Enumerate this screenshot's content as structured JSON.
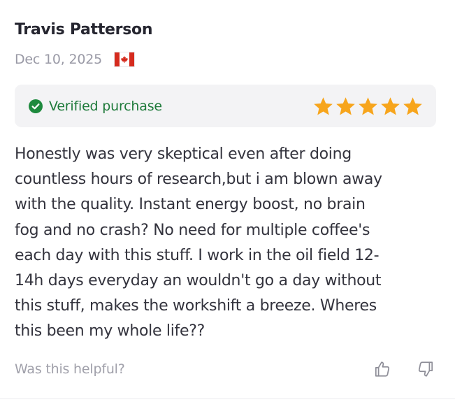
{
  "review": {
    "reviewer_name": "Travis Patterson",
    "date": "Dec 10, 2025",
    "country_flag": "canada-flag-icon",
    "verified_label": "Verified purchase",
    "verified_color": "#1e8a3e",
    "rating": 5,
    "rating_max": 5,
    "star_color": "#f7a51c",
    "body_lines": [
      "Honestly was very skeptical even after doing",
      "countless hours of research,but i am blown away",
      "with the quality. Instant energy boost, no brain",
      "fog and no crash? No need for multiple coffee's",
      "each day with this stuff. I work in the oil field 12-",
      "14h days everyday an wouldn't go a day without",
      "this stuff, makes the workshift a breeze. Wheres",
      "this been my whole life??"
    ]
  },
  "feedback": {
    "helpful_label": "Was this helpful?",
    "thumbs_up_icon": "thumbs-up-icon",
    "thumbs_down_icon": "thumbs-down-icon"
  }
}
